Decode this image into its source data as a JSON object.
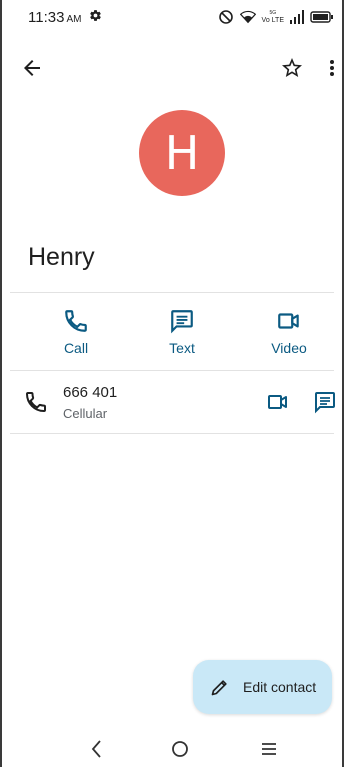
{
  "status_bar": {
    "time": "11:33",
    "ampm": "AM",
    "network_label": "Vo LTE",
    "network_speed": "5G"
  },
  "app_bar": {
    "back_icon": "arrow-left-icon",
    "star_icon": "star-outline-icon",
    "more_icon": "more-vert-icon"
  },
  "contact": {
    "initial": "H",
    "name": "Henry",
    "avatar_color": "#e8675c"
  },
  "actions": [
    {
      "label": "Call",
      "icon": "phone-icon"
    },
    {
      "label": "Text",
      "icon": "message-icon"
    },
    {
      "label": "Video",
      "icon": "videocam-icon"
    }
  ],
  "phone_entry": {
    "number": "666 401",
    "type": "Cellular"
  },
  "fab": {
    "label": "Edit contact",
    "icon": "pencil-icon"
  },
  "colors": {
    "accent": "#0b5a82",
    "fab_bg": "#c9e8f7"
  }
}
